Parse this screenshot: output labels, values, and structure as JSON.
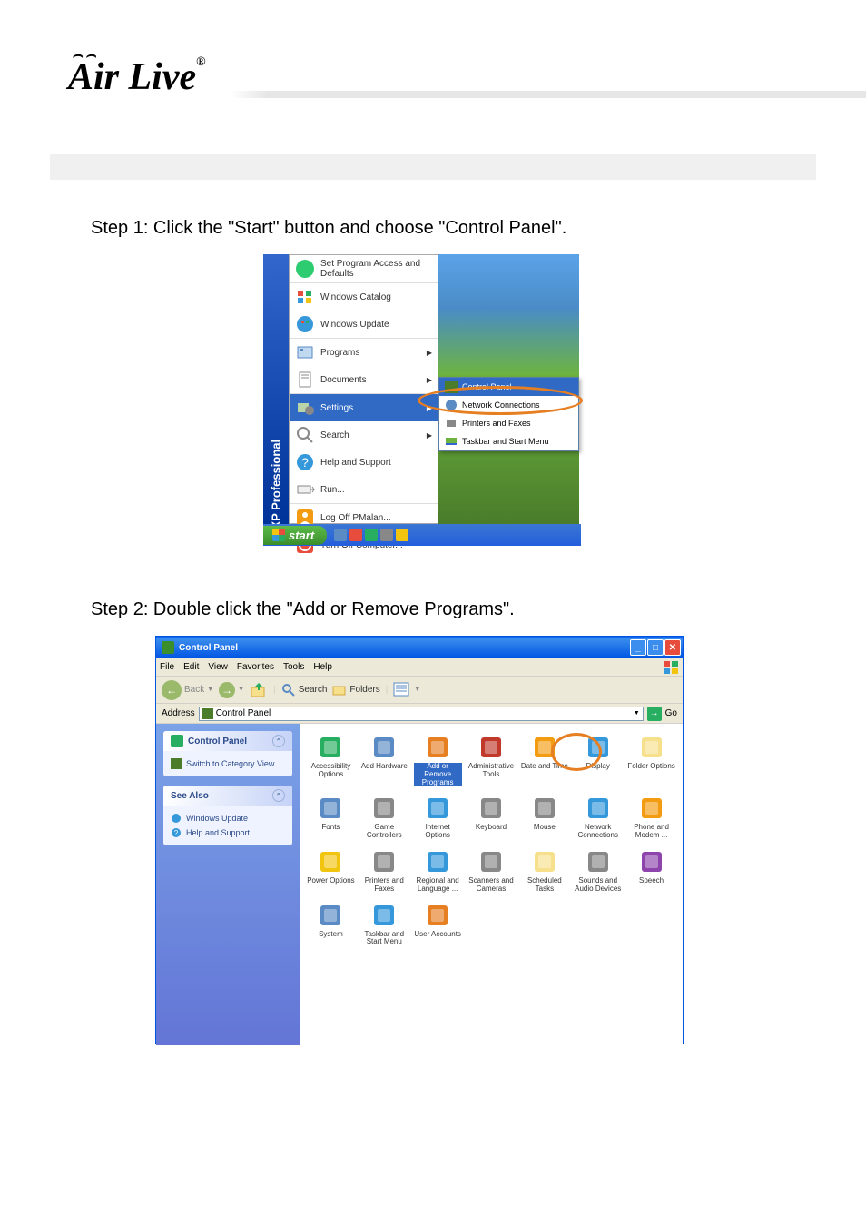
{
  "brand": {
    "name": "Air Live"
  },
  "steps": [
    "Step 1: Click the \"Start\" button and choose \"Control Panel\".",
    "Step 2: Double click the \"Add or Remove Programs\"."
  ],
  "startMenu": {
    "sidebar": "Windows XP Professional",
    "startBtn": "start",
    "items": [
      "Set Program Access and Defaults",
      "Windows Catalog",
      "Windows Update",
      "Programs",
      "Documents",
      "Settings",
      "Search",
      "Help and Support",
      "Run...",
      "Log Off PMalan...",
      "Turn Off Computer..."
    ],
    "submenu": [
      "Control Panel",
      "Network Connections",
      "Printers and Faxes",
      "Taskbar and Start Menu"
    ]
  },
  "controlPanel": {
    "title": "Control Panel",
    "menus": [
      "File",
      "Edit",
      "View",
      "Favorites",
      "Tools",
      "Help"
    ],
    "toolbar": {
      "back": "Back",
      "search": "Search",
      "folders": "Folders"
    },
    "addressLabel": "Address",
    "addressValue": "Control Panel",
    "goLabel": "Go",
    "side": {
      "cpTitle": "Control Panel",
      "switchView": "Switch to Category View",
      "seeAlso": "See Also",
      "links": [
        "Windows Update",
        "Help and Support"
      ]
    },
    "icons": [
      {
        "label": "Accessibility Options",
        "color": "#27ae60",
        "name": "accessibility-options"
      },
      {
        "label": "Add Hardware",
        "color": "#5a8bc4",
        "name": "add-hardware"
      },
      {
        "label": "Add or Remove Programs",
        "color": "#e67e22",
        "name": "add-remove-programs",
        "selected": true
      },
      {
        "label": "Administrative Tools",
        "color": "#c0392b",
        "name": "administrative-tools"
      },
      {
        "label": "Date and Time",
        "color": "#f39c12",
        "name": "date-and-time"
      },
      {
        "label": "Display",
        "color": "#3498db",
        "name": "display"
      },
      {
        "label": "Folder Options",
        "color": "#f7e08c",
        "name": "folder-options"
      },
      {
        "label": "Fonts",
        "color": "#5a8bc4",
        "name": "fonts"
      },
      {
        "label": "Game Controllers",
        "color": "#888",
        "name": "game-controllers"
      },
      {
        "label": "Internet Options",
        "color": "#3498db",
        "name": "internet-options"
      },
      {
        "label": "Keyboard",
        "color": "#888",
        "name": "keyboard"
      },
      {
        "label": "Mouse",
        "color": "#888",
        "name": "mouse"
      },
      {
        "label": "Network Connections",
        "color": "#3498db",
        "name": "network-connections"
      },
      {
        "label": "Phone and Modem ...",
        "color": "#f39c12",
        "name": "phone-modem"
      },
      {
        "label": "Power Options",
        "color": "#f1c40f",
        "name": "power-options"
      },
      {
        "label": "Printers and Faxes",
        "color": "#888",
        "name": "printers-faxes"
      },
      {
        "label": "Regional and Language ...",
        "color": "#3498db",
        "name": "regional-language"
      },
      {
        "label": "Scanners and Cameras",
        "color": "#888",
        "name": "scanners-cameras"
      },
      {
        "label": "Scheduled Tasks",
        "color": "#f7e08c",
        "name": "scheduled-tasks"
      },
      {
        "label": "Sounds and Audio Devices",
        "color": "#888",
        "name": "sounds-audio"
      },
      {
        "label": "Speech",
        "color": "#8e44ad",
        "name": "speech"
      },
      {
        "label": "System",
        "color": "#5a8bc4",
        "name": "system"
      },
      {
        "label": "Taskbar and Start Menu",
        "color": "#3498db",
        "name": "taskbar-start-menu"
      },
      {
        "label": "User Accounts",
        "color": "#e67e22",
        "name": "user-accounts"
      }
    ]
  }
}
